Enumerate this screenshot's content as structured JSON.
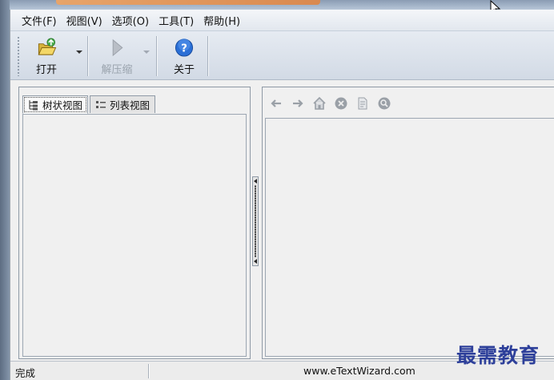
{
  "menu": {
    "items": [
      "文件(F)",
      "视图(V)",
      "选项(O)",
      "工具(T)",
      "帮助(H)"
    ]
  },
  "toolbar": {
    "open_label": "打开",
    "decompress_label": "解压缩",
    "about_label": "关于"
  },
  "left_pane": {
    "tabs": [
      {
        "label": "树状视图",
        "icon": "tree-view-icon",
        "active": true
      },
      {
        "label": "列表视图",
        "icon": "list-view-icon",
        "active": false
      }
    ]
  },
  "right_pane": {
    "nav_icons": [
      "back-arrow-icon",
      "forward-arrow-icon",
      "home-icon",
      "stop-icon",
      "document-icon",
      "search-icon"
    ]
  },
  "statusbar": {
    "status": "完成",
    "url": "www.eTextWizard.com"
  },
  "watermark": {
    "text": "最需教育"
  },
  "colors": {
    "toolbar_bg": "#d8e0ea",
    "panel_border": "#8f9aa6",
    "watermark": "#2d3f9a",
    "about_icon": "#2a6fd6",
    "open_icon": "#e9c84a"
  }
}
